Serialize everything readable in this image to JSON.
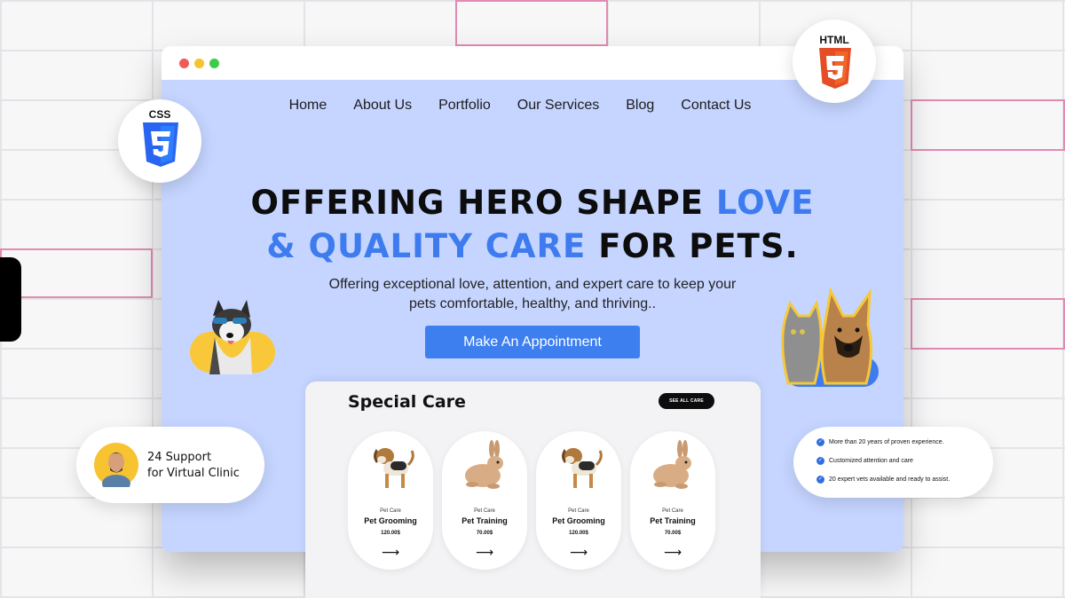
{
  "nav": {
    "items": [
      "Home",
      "About Us",
      "Portfolio",
      "Our Services",
      "Blog",
      "Contact Us"
    ]
  },
  "hero": {
    "line1_main": "OFFERING HERO SHAPE ",
    "line1_accent": "LOVE",
    "line2_accent": "& QUALITY CARE",
    "line2_main": " FOR PETS.",
    "subtitle_line1": "Offering exceptional love, attention, and expert care to keep your",
    "subtitle_line2": "pets comfortable, healthy, and thriving..",
    "cta_label": "Make An Appointment"
  },
  "special_care": {
    "title": "Special Care",
    "see_all_label": "SEE ALL CARE",
    "cards": [
      {
        "category": "Pet Care",
        "name": "Pet Grooming",
        "price": "120.00$",
        "animal": "dog-icon"
      },
      {
        "category": "Pet Care",
        "name": "Pet Training",
        "price": "70.00$",
        "animal": "rabbit-icon"
      },
      {
        "category": "Pet Care",
        "name": "Pet Grooming",
        "price": "120.00$",
        "animal": "dog-icon"
      },
      {
        "category": "Pet Care",
        "name": "Pet Training",
        "price": "70.00$",
        "animal": "rabbit-icon"
      }
    ],
    "arrow": "⟶"
  },
  "badges": {
    "css_label": "CSS",
    "html_label": "HTML"
  },
  "support": {
    "line1": "24 Support",
    "line2": "for Virtual Clinic"
  },
  "features": [
    "More than 20 years of proven experience.",
    "Customized attention and care",
    "20 expert vets available and ready to assist."
  ],
  "colors": {
    "accent": "#3d7bef",
    "hero_bg": "#c5d5ff",
    "yellow": "#f9c83a",
    "css_blue": "#2965f1",
    "html_orange": "#e44d26"
  }
}
